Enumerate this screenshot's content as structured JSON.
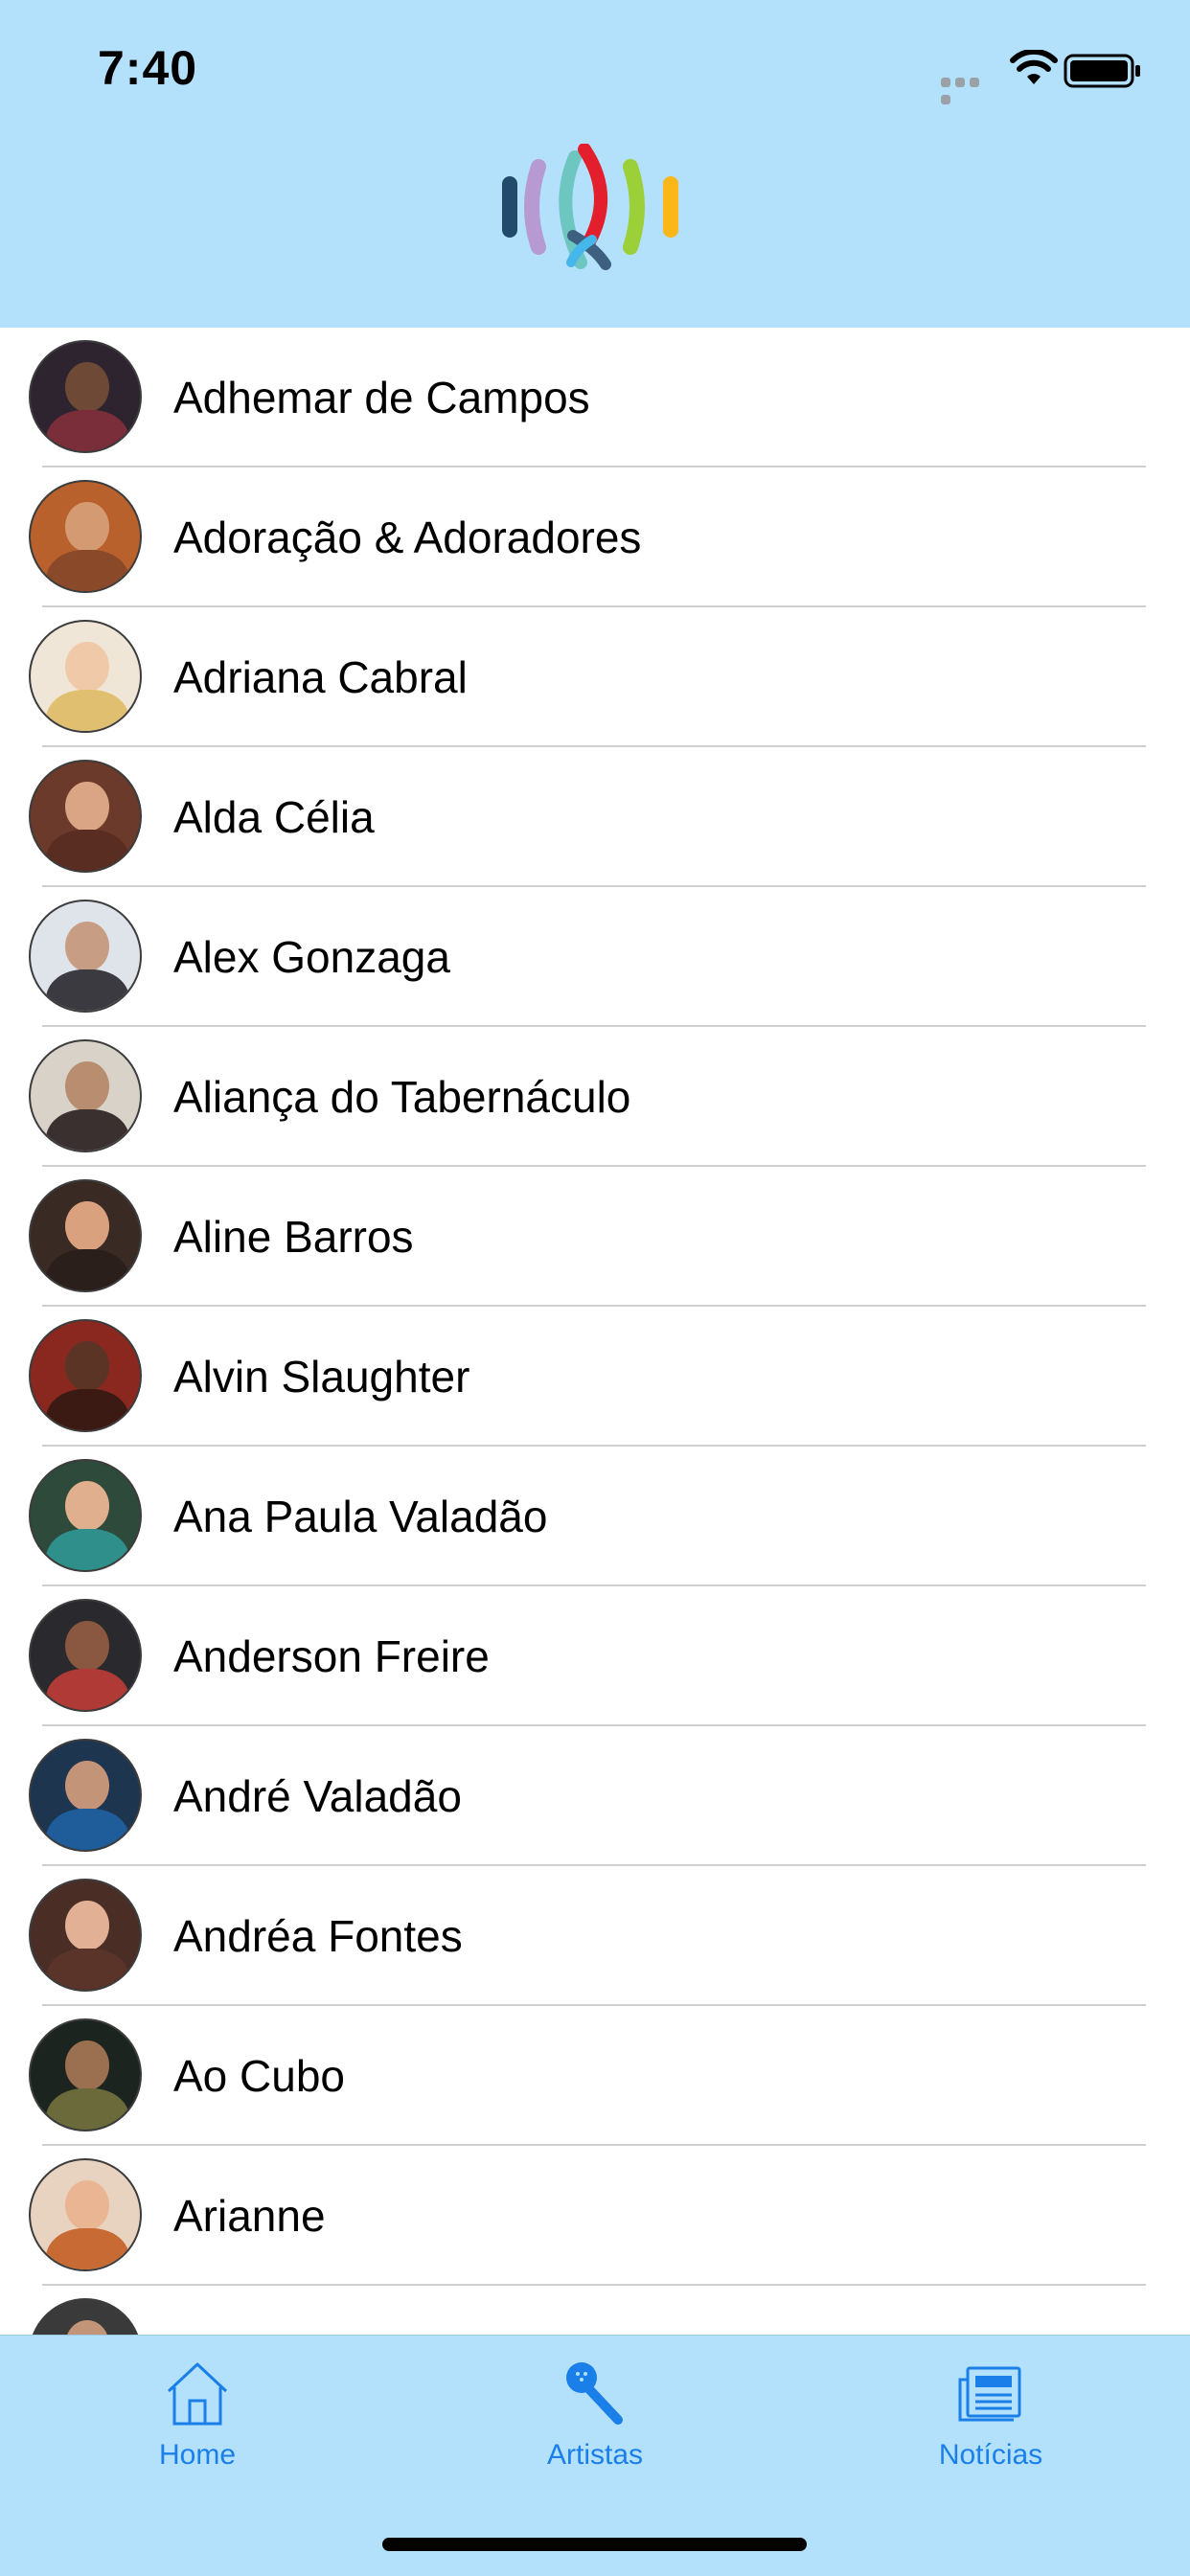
{
  "status_bar": {
    "time": "7:40"
  },
  "artists": [
    {
      "name": "Adhemar de Campos"
    },
    {
      "name": "Adoração & Adoradores"
    },
    {
      "name": "Adriana Cabral"
    },
    {
      "name": "Alda Célia"
    },
    {
      "name": "Alex Gonzaga"
    },
    {
      "name": "Aliança do Tabernáculo"
    },
    {
      "name": "Aline Barros"
    },
    {
      "name": "Alvin Slaughter"
    },
    {
      "name": "Ana Paula Valadão"
    },
    {
      "name": "Anderson Freire"
    },
    {
      "name": "André Valadão"
    },
    {
      "name": "Andréa Fontes"
    },
    {
      "name": "Ao Cubo"
    },
    {
      "name": "Arianne"
    }
  ],
  "tabs": [
    {
      "label": "Home",
      "icon": "home-icon"
    },
    {
      "label": "Artistas",
      "icon": "microphone-icon",
      "selected": true
    },
    {
      "label": "Notícias",
      "icon": "newspaper-icon"
    }
  ],
  "colors": {
    "bar_background": "#b3e0fb",
    "accent": "#1a7fe8"
  }
}
